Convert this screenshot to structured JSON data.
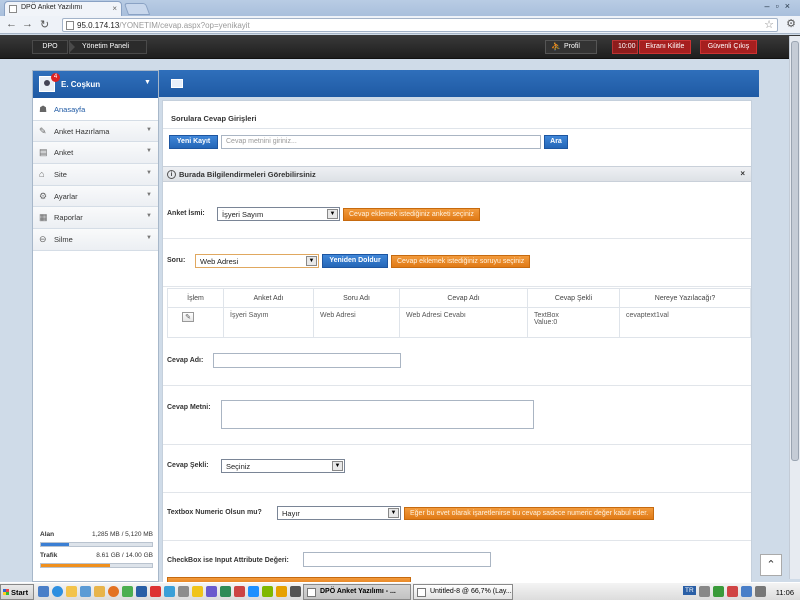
{
  "browser": {
    "tab_title": "DPÖ Anket Yazılımı",
    "url_host": "95.0.174.13",
    "url_path": "/YONETIM/cevap.aspx?op=yenikayit"
  },
  "header": {
    "crumb_root": "DPO",
    "crumb_panel": "Yönetim Paneli",
    "profile_label": "Profil",
    "timer": "10:00",
    "lock_label": "Ekranı Kilitle",
    "logout_label": "Güvenli Çıkış"
  },
  "user": {
    "name": "E. Coşkun",
    "notification_count": "4"
  },
  "sidebar": {
    "items": [
      {
        "label": "Anasayfa"
      },
      {
        "label": "Anket Hazırlama"
      },
      {
        "label": "Anket"
      },
      {
        "label": "Site"
      },
      {
        "label": "Ayarlar"
      },
      {
        "label": "Raporlar"
      },
      {
        "label": "Silme"
      }
    ],
    "storage": {
      "label": "Alan",
      "value": "1,285 MB / 5,120 MB",
      "fraction": 0.25,
      "color": "#3b7fd4"
    },
    "traffic": {
      "label": "Trafik",
      "value": "8.61 GB / 14.00 GB",
      "fraction": 0.62,
      "color": "#f0901e"
    }
  },
  "main": {
    "section_title": "Sorulara Cevap Girişleri",
    "new_button": "Yeni Kayıt",
    "search_placeholder": "Cevap metnini giriniz...",
    "search_button": "Ara",
    "info_title": "Burada Bilgilendirmeleri Görebilirsiniz",
    "info_close": "×",
    "survey_label": "Anket İsmi:",
    "survey_value": "İşyeri Sayım",
    "survey_hint": "Cevap eklemek istediğiniz anketi seçiniz",
    "question_label": "Soru:",
    "question_value": "Web Adresi",
    "refill_button": "Yeniden Doldur",
    "question_hint": "Cevap eklemek istediğiniz soruyu seçiniz",
    "table": {
      "headers": [
        "İşlem",
        "Anket Adı",
        "Soru Adı",
        "Cevap Adı",
        "Cevap Şekli",
        "Nereye Yazılacağı?"
      ],
      "rows": [
        {
          "survey": "İşyeri Sayım",
          "question": "Web Adresi",
          "answer": "Web Adresi Cevabı",
          "shape_line1": "TextBox",
          "shape_line2": "Value:0",
          "target": "cevaptext1val"
        }
      ]
    },
    "answer_name_label": "Cevap Adı:",
    "answer_text_label": "Cevap Metni:",
    "answer_shape_label": "Cevap Şekli:",
    "answer_shape_value": "Seçiniz",
    "numeric_label": "Textbox Numeric Olsun mu?",
    "numeric_value": "Hayır",
    "numeric_hint": "Eğer bu evet olarak işaretlenirse bu cevap sadece numeric değer kabul eder.",
    "checkbox_label": "CheckBox ise Input Attribute Değeri:"
  },
  "taskbar": {
    "start": "Start",
    "tasks": [
      {
        "label": "DPÖ Anket Yazılımı - ..."
      },
      {
        "label": "Untitled-8 @ 66,7% (Lay..."
      }
    ],
    "lang": "TR",
    "clock": "11:06"
  }
}
